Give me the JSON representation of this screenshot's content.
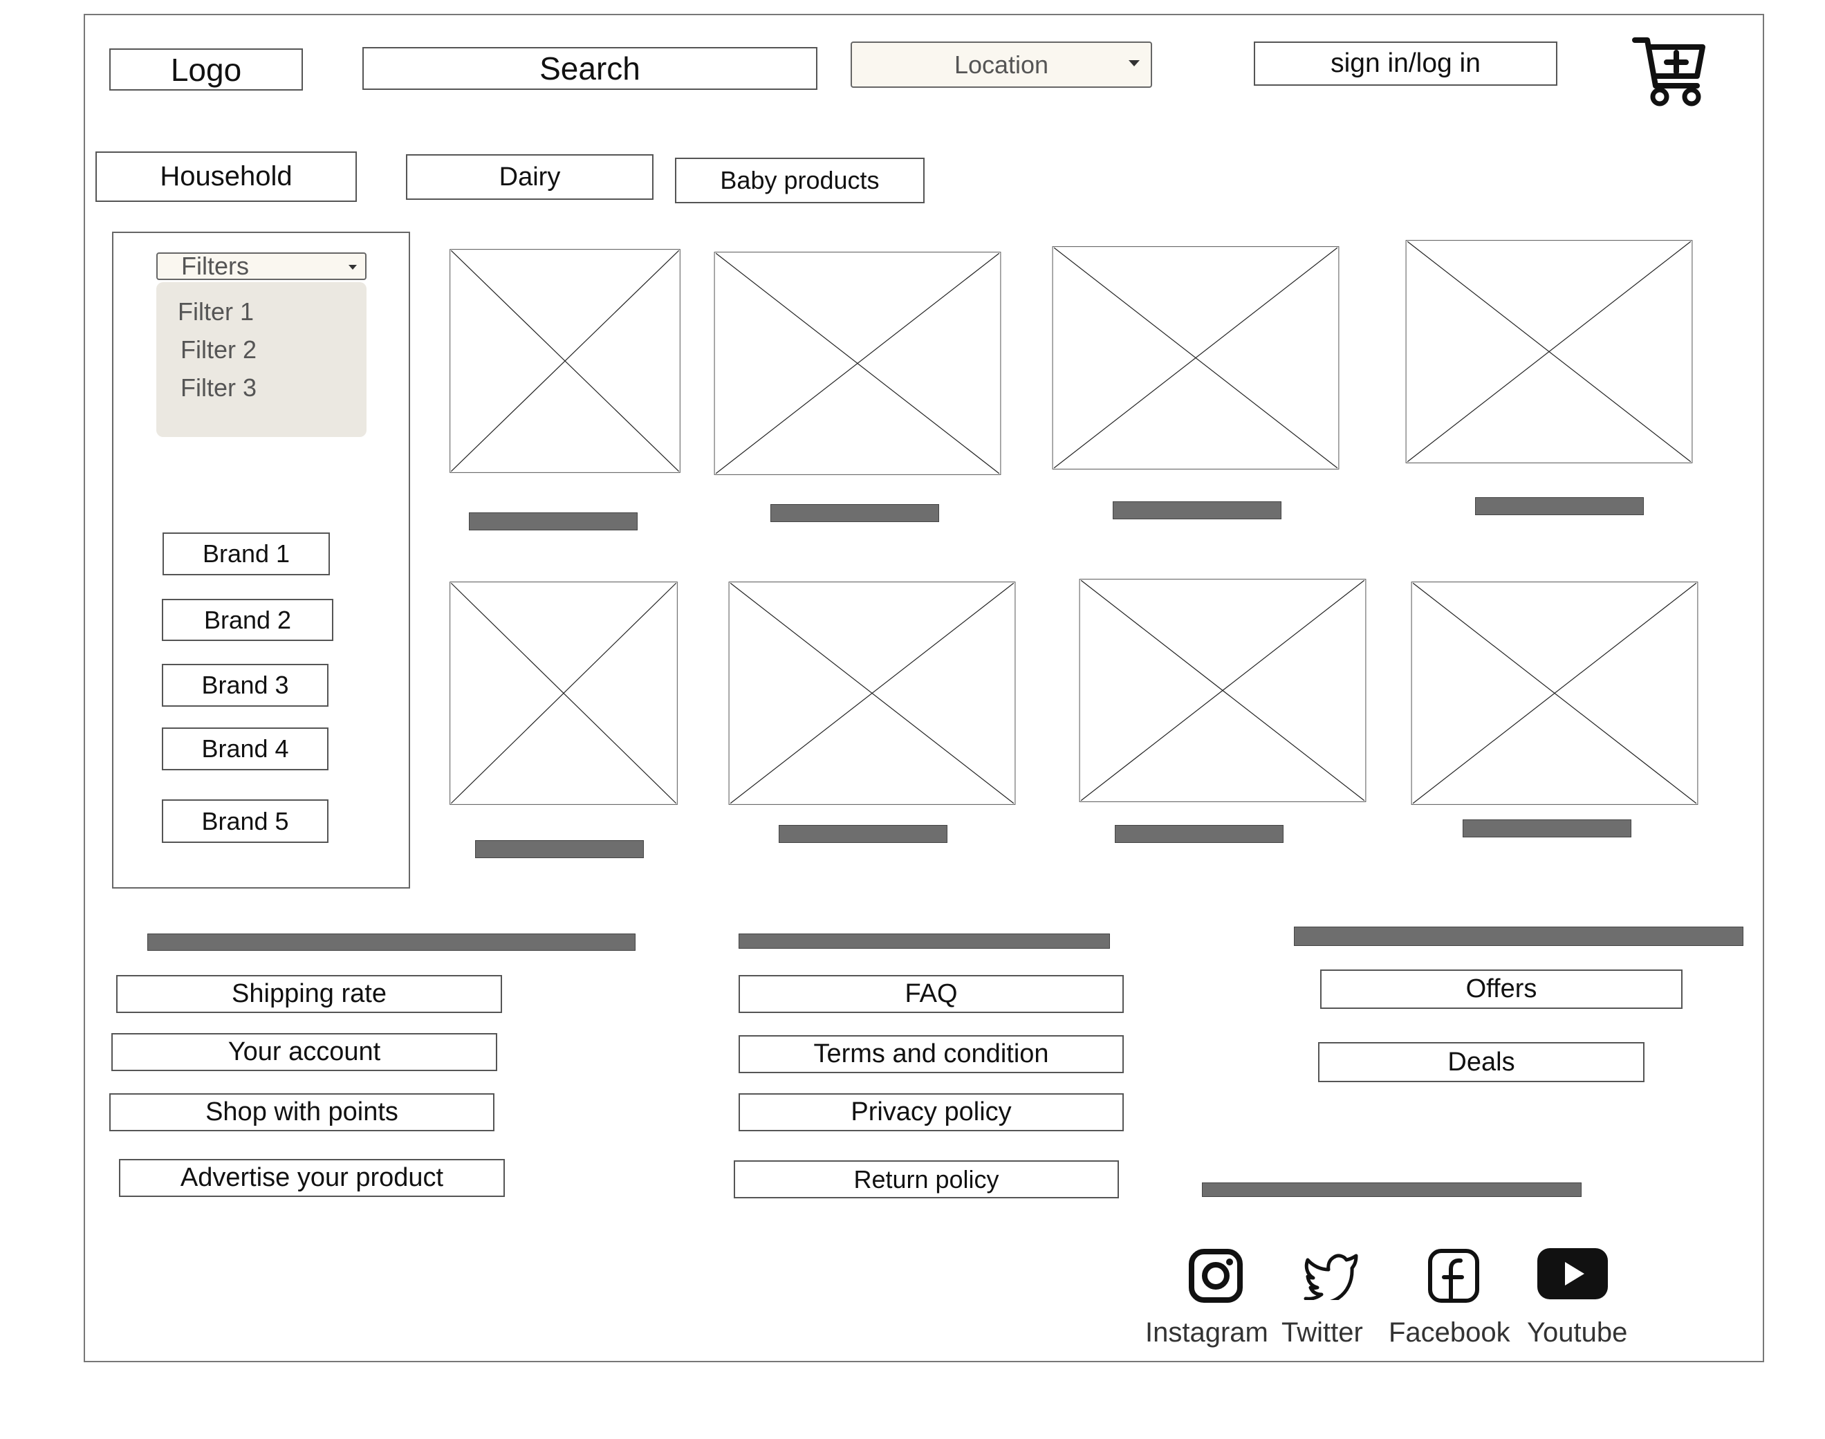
{
  "header": {
    "logo": "Logo",
    "search": "Search",
    "location": "Location",
    "signin": "sign in/log in",
    "cart_icon": "cart-plus-icon"
  },
  "categories": [
    "Household",
    "Dairy",
    "Baby products"
  ],
  "filters": {
    "dropdown_label": "Filters",
    "items": [
      "Filter 1",
      "Filter 2",
      "Filter 3"
    ]
  },
  "brands": [
    "Brand 1",
    "Brand 2",
    "Brand 3",
    "Brand 4",
    "Brand 5"
  ],
  "footer": {
    "col1": [
      "Shipping rate",
      "Your account",
      "Shop with points",
      "Advertise your product"
    ],
    "col2": [
      "FAQ",
      "Terms and condition",
      "Privacy policy",
      "Return policy"
    ],
    "col3": [
      "Offers",
      "Deals"
    ]
  },
  "social": [
    {
      "label": "Instagram",
      "icon": "instagram-icon"
    },
    {
      "label": "Twitter",
      "icon": "twitter-icon"
    },
    {
      "label": "Facebook",
      "icon": "facebook-icon"
    },
    {
      "label": "Youtube",
      "icon": "youtube-icon"
    }
  ]
}
